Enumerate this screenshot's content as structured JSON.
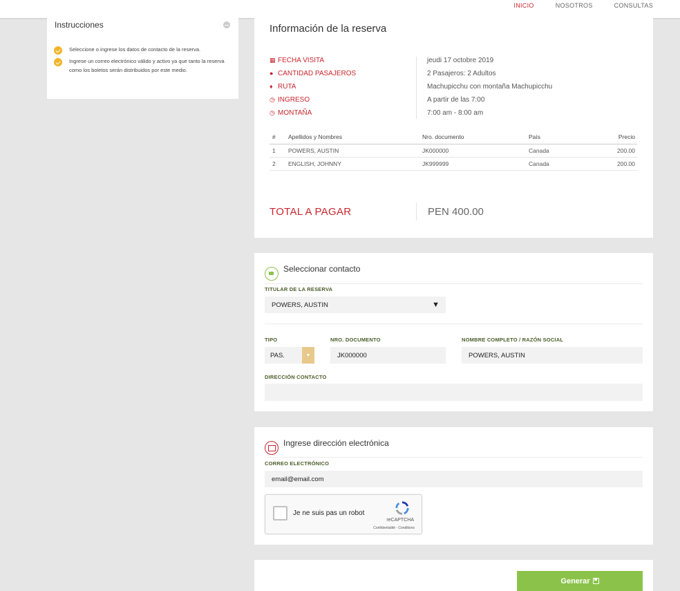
{
  "nav": {
    "items": [
      {
        "label": "INICIO"
      },
      {
        "label": "NOSOTROS"
      },
      {
        "label": "CONSULTAS"
      }
    ]
  },
  "sidebar": {
    "title": "Instrucciones",
    "instructions": [
      "Seleccione o ingrese los datos de contacto de la reserva.",
      "Ingrese un correo electrónico válido y activo ya que tanto la reserva como los boletos serán distribuidos por este medio."
    ]
  },
  "reserva": {
    "title": "Información de la reserva",
    "fields": [
      {
        "icon": "calendar-icon",
        "label": "FECHA VISITA",
        "value": "jeudi 17 octobre 2019"
      },
      {
        "icon": "users-icon",
        "label": "CANTIDAD PASAJEROS",
        "value": "2 Pasajeros: 2 Adultos"
      },
      {
        "icon": "map-marker-icon",
        "label": "RUTA",
        "value": "Machupicchu con montaña Machupicchu"
      },
      {
        "icon": "clock-icon",
        "label": "INGRESO",
        "value": "A partir de las 7:00"
      },
      {
        "icon": "clock-icon",
        "label": "MONTAÑA",
        "value": "7:00 am - 8:00 am"
      }
    ],
    "table": {
      "headers": [
        "#",
        "Apellidos y Nombres",
        "Nro. documento",
        "País",
        "Precio"
      ],
      "rows": [
        [
          "1",
          "POWERS, AUSTIN",
          "JK000000",
          "Canada",
          "200.00"
        ],
        [
          "2",
          "ENGLISH, JOHNNY",
          "JK999999",
          "Canada",
          "200.00"
        ]
      ]
    },
    "total_label": "TOTAL A PAGAR",
    "total_value": "PEN 400.00"
  },
  "contacto": {
    "title": "Seleccionar contacto",
    "titular_label": "TITULAR DE LA RESERVA",
    "titular_value": "POWERS, AUSTIN",
    "tipo_label": "TIPO",
    "tipo_value": "PAS.",
    "nro_label": "NRO. DOCUMENTO",
    "nro_value": "JK000000",
    "nombre_label": "NOMBRE COMPLETO / RAZÓN SOCIAL",
    "nombre_value": "POWERS, AUSTIN",
    "direccion_label": "DIRECCIÓN CONTACTO",
    "direccion_value": ""
  },
  "correo": {
    "title": "Ingrese dirección electrónica",
    "email_label": "CORREO ELECTRÓNICO",
    "email_value": "email@email.com",
    "captcha_text": "Je ne suis pas un robot",
    "captcha_brand": "reCAPTCHA",
    "captcha_terms": "Confidentialité - Conditions"
  },
  "generar_label": "Generar",
  "colors": {
    "accent_red": "#c8262e",
    "accent_green": "#8bc34a",
    "check_yellow": "#f0b429"
  }
}
